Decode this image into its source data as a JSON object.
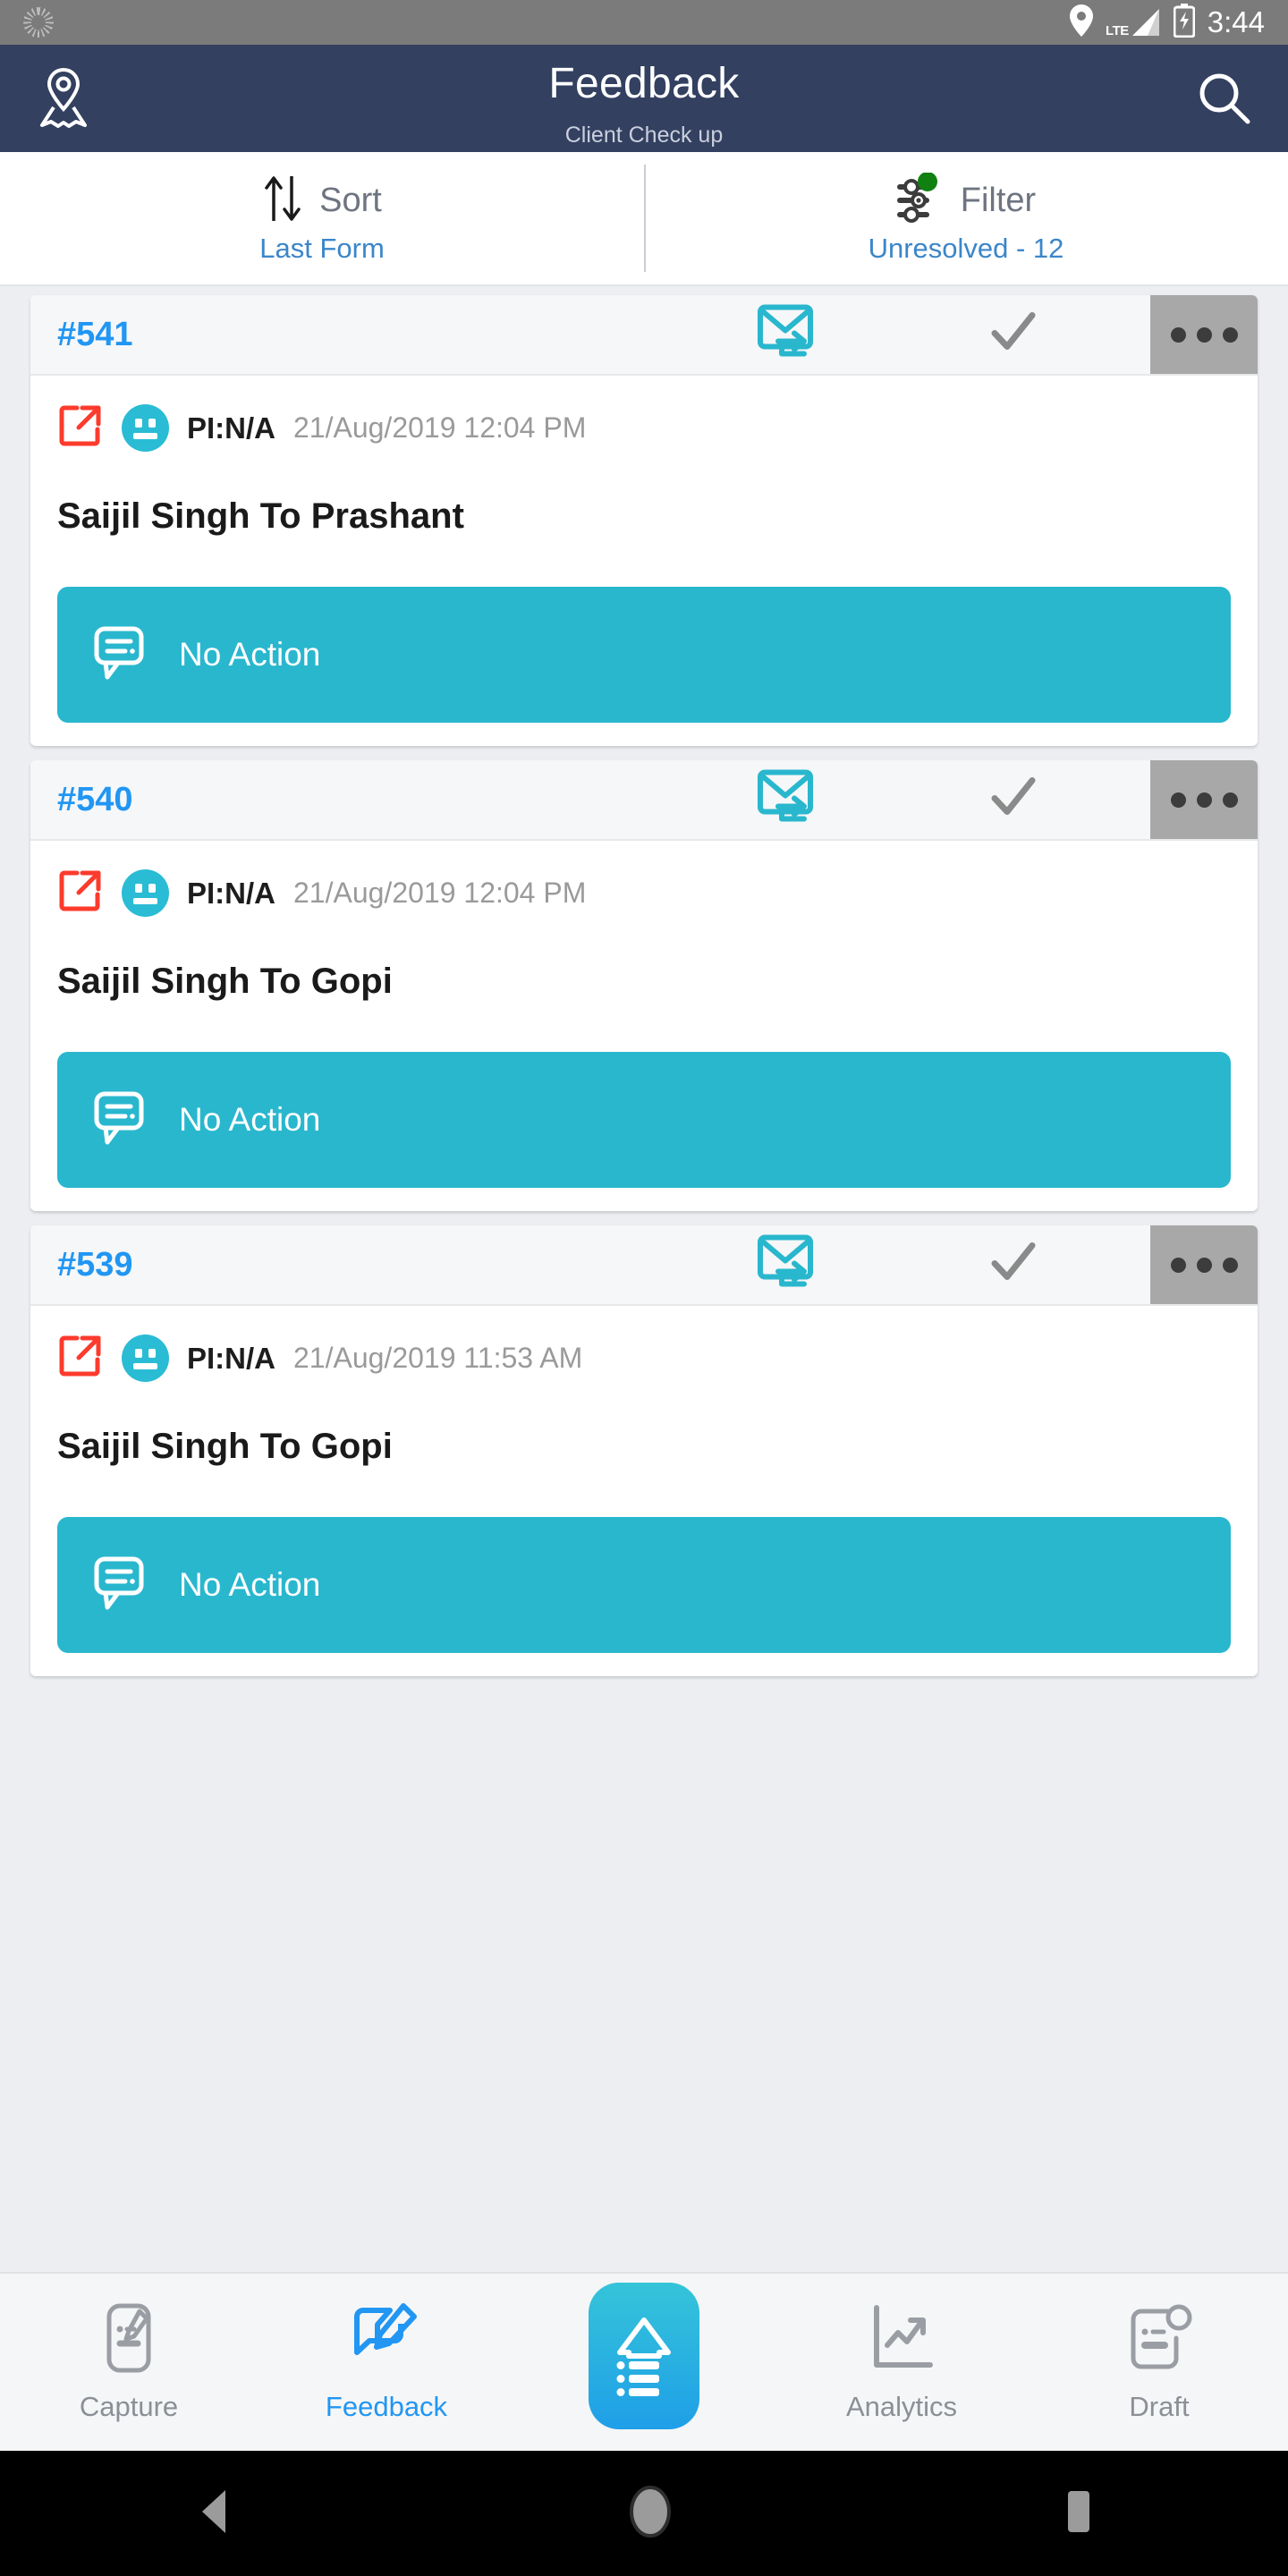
{
  "status_bar": {
    "left_icon": "sync-spinner-icon",
    "location_icon": "location-pin-icon",
    "network_label": "LTE",
    "signal_icon": "signal-bars-icon",
    "battery_icon": "battery-charging-icon",
    "time": "3:44"
  },
  "header": {
    "left_icon": "map-pin-icon",
    "title": "Feedback",
    "subtitle": "Client Check up",
    "right_icon": "search-icon",
    "background": "#334060"
  },
  "toolbar": {
    "sort": {
      "icon": "sort-arrows-icon",
      "label": "Sort",
      "value": "Last Form"
    },
    "filter": {
      "icon": "filter-sliders-icon",
      "badge_color": "#108010",
      "label": "Filter",
      "value": "Unresolved - 12"
    }
  },
  "colors": {
    "accent_blue": "#2196f3",
    "link_blue": "#3b86c9",
    "teal": "#29b7ce",
    "header_navy": "#334060",
    "red": "#fc3b2d",
    "gray": "#a8a8a8"
  },
  "cards": [
    {
      "id": "#541",
      "mail_icon": "mail-forward-icon",
      "check_icon": "check-icon",
      "more_icon": "more-options-icon",
      "share_icon": "external-link-icon",
      "mood_icon": "neutral-face-icon",
      "pi": "PI:N/A",
      "timestamp": "21/Aug/2019 12:04 PM",
      "person": "Saijil Singh To Prashant",
      "action": {
        "icon": "comment-icon",
        "label": "No Action"
      }
    },
    {
      "id": "#540",
      "mail_icon": "mail-forward-icon",
      "check_icon": "check-icon",
      "more_icon": "more-options-icon",
      "share_icon": "external-link-icon",
      "mood_icon": "neutral-face-icon",
      "pi": "PI:N/A",
      "timestamp": "21/Aug/2019 12:04 PM",
      "person": "Saijil Singh To Gopi",
      "action": {
        "icon": "comment-icon",
        "label": "No Action"
      }
    },
    {
      "id": "#539",
      "mail_icon": "mail-forward-icon",
      "check_icon": "check-icon",
      "more_icon": "more-options-icon",
      "share_icon": "external-link-icon",
      "mood_icon": "neutral-face-icon",
      "pi": "PI:N/A",
      "timestamp": "21/Aug/2019 11:53 AM",
      "person": "Saijil Singh To Gopi",
      "action": {
        "icon": "comment-icon",
        "label": "No Action"
      }
    }
  ],
  "bottom_nav": [
    {
      "icon": "capture-note-icon",
      "label": "Capture",
      "active": false
    },
    {
      "icon": "feedback-pencil-icon",
      "label": "Feedback",
      "active": true
    },
    {
      "icon": "home-list-icon",
      "label": "",
      "active": false
    },
    {
      "icon": "analytics-chart-icon",
      "label": "Analytics",
      "active": false
    },
    {
      "icon": "draft-doc-icon",
      "label": "Draft",
      "active": false
    }
  ],
  "android_nav": {
    "back": "back-triangle-icon",
    "home": "home-circle-icon",
    "recent": "recents-square-icon"
  }
}
